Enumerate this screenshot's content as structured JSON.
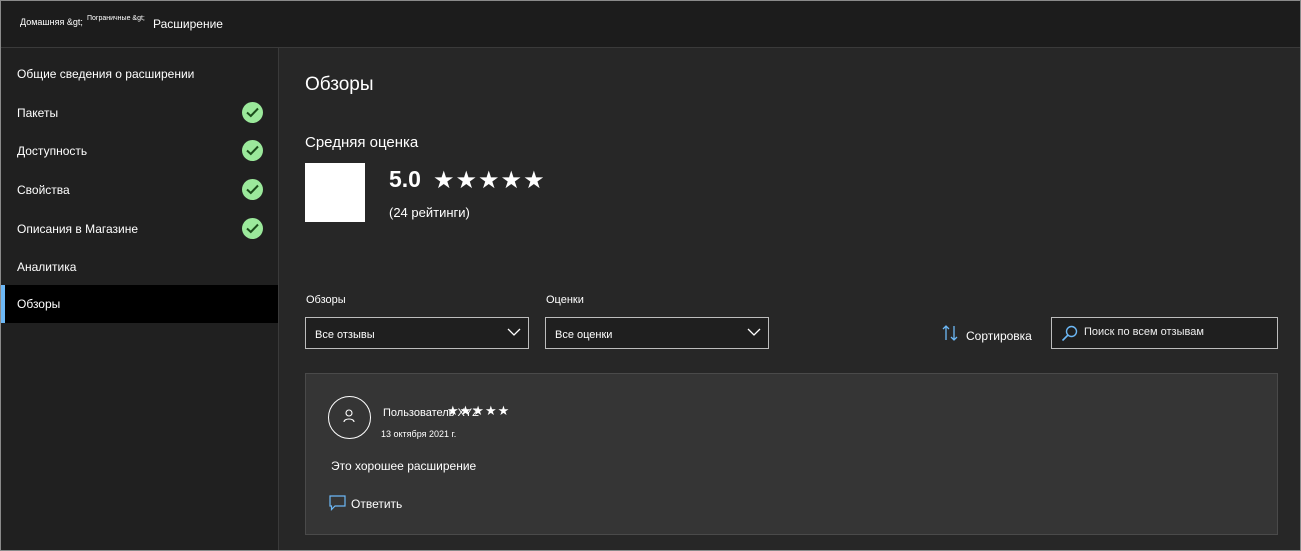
{
  "breadcrumb": {
    "home": "Домашняя &gt;",
    "category": "Пограничные &gt;",
    "current": "Расширение"
  },
  "sidebar": {
    "items": [
      {
        "label": "Общие сведения о расширении",
        "checked": false,
        "active": false
      },
      {
        "label": "Пакеты",
        "checked": true,
        "active": false
      },
      {
        "label": "Доступность",
        "checked": true,
        "active": false
      },
      {
        "label": "Свойства",
        "checked": true,
        "active": false
      },
      {
        "label": "Описания в Магазине",
        "checked": true,
        "active": false
      },
      {
        "label": "Аналитика",
        "checked": false,
        "active": false
      },
      {
        "label": "Обзоры",
        "checked": false,
        "active": true
      }
    ]
  },
  "main": {
    "title": "Обзоры",
    "average_heading": "Средняя оценка",
    "score": "5.0",
    "stars": "★★★★★",
    "ratings_count": "(24 рейтинги)",
    "filters": {
      "reviews_label": "Обзоры",
      "reviews_value": "Все отзывы",
      "ratings_label": "Оценки",
      "ratings_value": "Все оценки",
      "sort_label": "Сортировка",
      "search_placeholder": "Поиск по всем отзывам"
    },
    "review": {
      "user": "Пользователь XYZ",
      "stars": "★★★★★",
      "date": "13 октября 2021 г.",
      "text": "Это хорошее расширение",
      "reply_label": "Ответить"
    }
  },
  "colors": {
    "accent": "#6cb8f6",
    "check": "#9be99b",
    "sidebar_active": "#000000"
  }
}
